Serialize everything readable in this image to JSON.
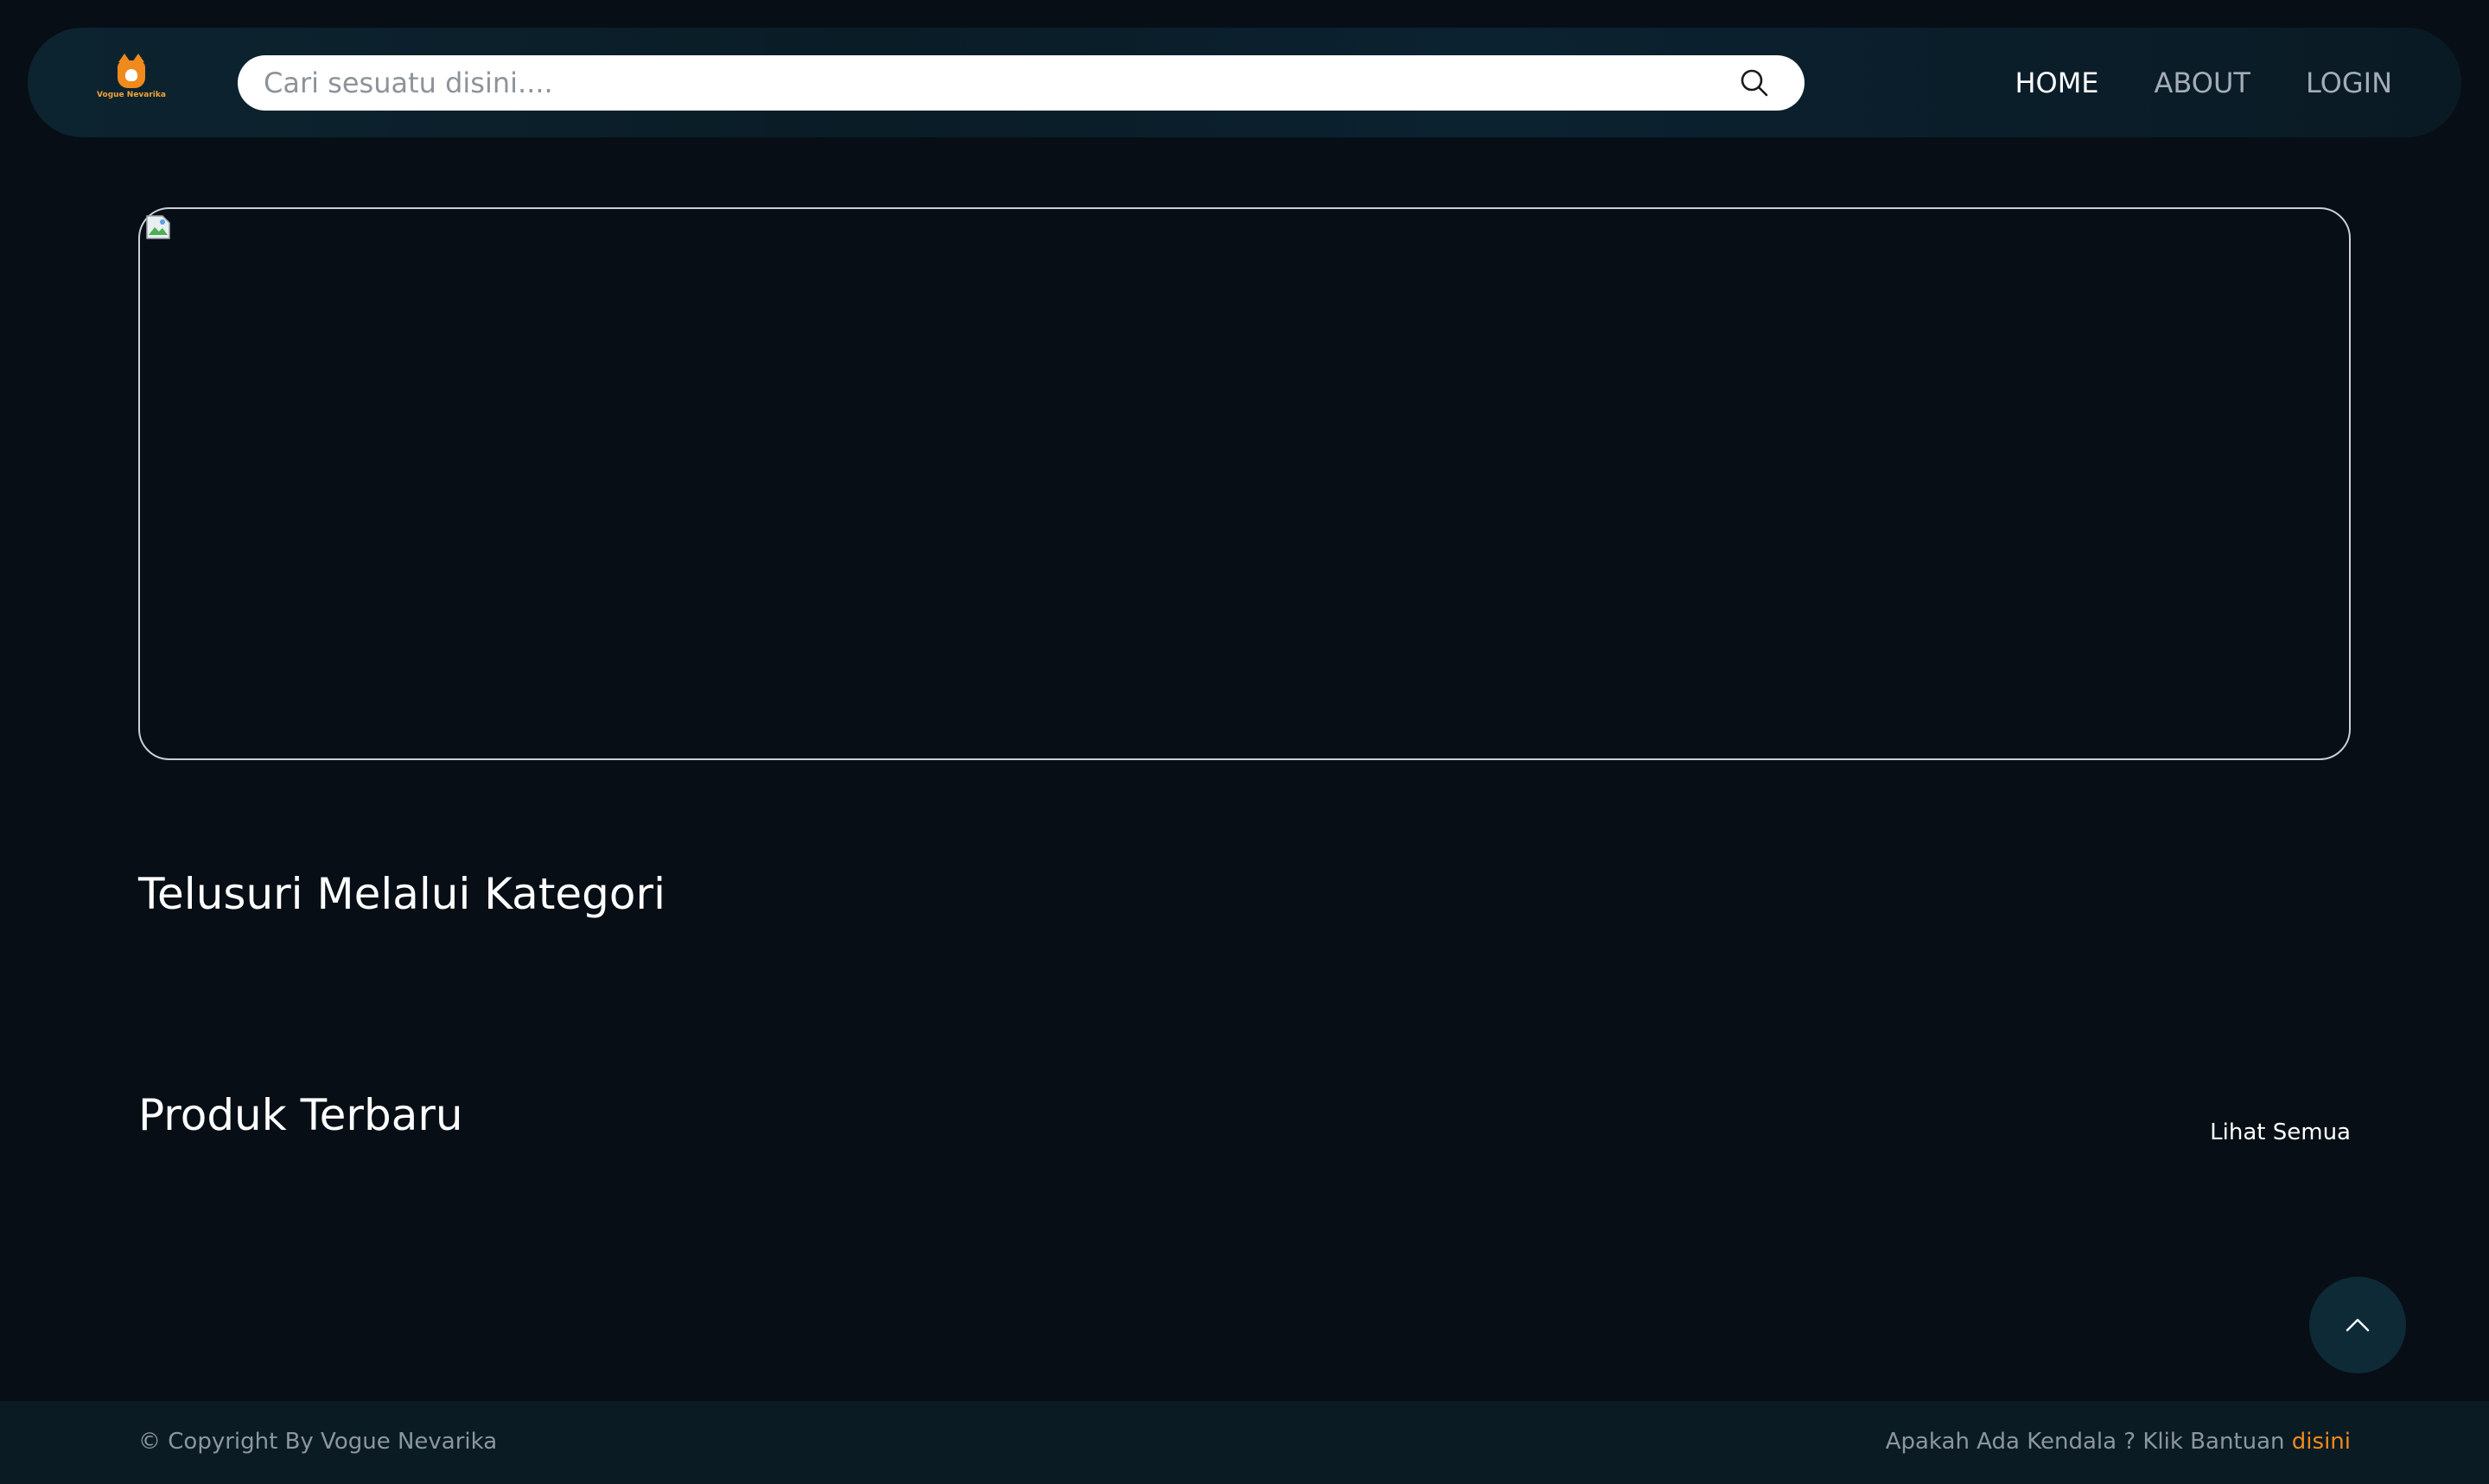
{
  "brand": {
    "logo_text": "Vogue Nevarika",
    "accent_color": "#f08a1d"
  },
  "search": {
    "placeholder": "Cari sesuatu disini....",
    "icon": "search-icon"
  },
  "nav": {
    "items": [
      {
        "label": "HOME",
        "active": true
      },
      {
        "label": "ABOUT",
        "active": false
      },
      {
        "label": "LOGIN",
        "active": false
      }
    ]
  },
  "banner": {
    "icon": "broken-image-icon"
  },
  "sections": {
    "categories_title": "Telusuri Melalui Kategori",
    "latest_title": "Produk Terbaru",
    "see_all_label": "Lihat Semua"
  },
  "scroll_top": {
    "icon": "chevron-up-icon"
  },
  "footer": {
    "copyright": "© Copyright By Vogue Nevarika",
    "help_text": "Apakah Ada Kendala ? Klik Bantuan ",
    "help_link": "disini"
  }
}
